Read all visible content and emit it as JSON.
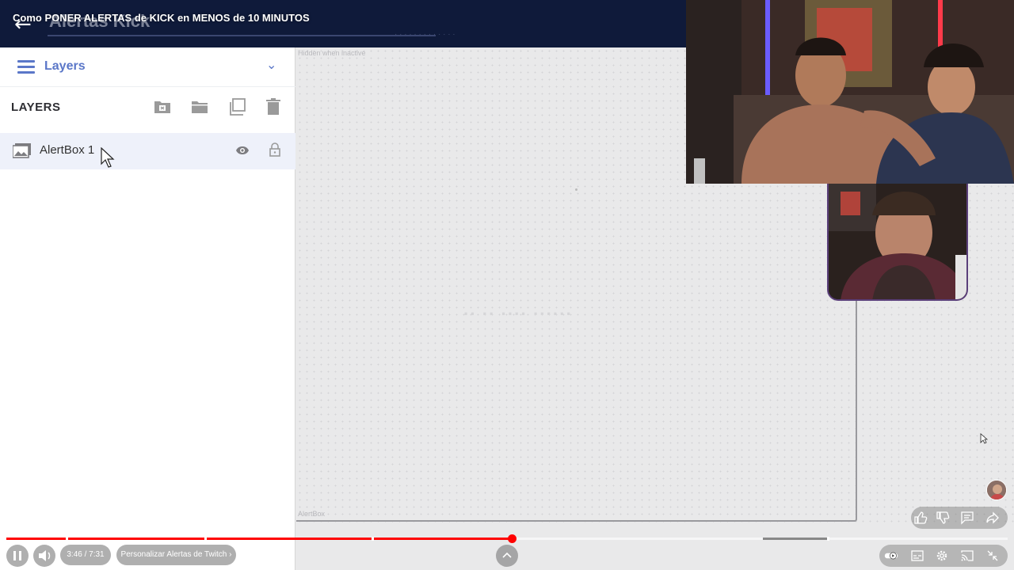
{
  "player": {
    "video_title": "Como PONER ALERTAS de KICK en MENOS de 10 MINUTOS",
    "time_display": "3:46 / 7:31",
    "chapter_label": "Personalizar Alertas de Twitch",
    "progress_fraction": 0.505
  },
  "app": {
    "title": "Alertas Kick",
    "panel_label": "Layers",
    "layers_title": "LAYERS",
    "layers": [
      {
        "name": "AlertBox 1"
      }
    ]
  },
  "canvas": {
    "hidden_note": "Hidden when inactive",
    "alertbox_label": "AlertBox"
  },
  "colors": {
    "topbar_bg": "#0f1a3a",
    "accent_blue": "#5b77c8",
    "progress_red": "#ff0000",
    "selected_row_bg": "#eef1fa"
  },
  "icons": {
    "back": "arrow-left-icon",
    "menu": "hamburger-icon",
    "expand": "chevron-down-icon",
    "tools": [
      "add-folder-icon",
      "folder-icon",
      "duplicate-icon",
      "trash-icon"
    ],
    "layer": "image-icon",
    "visibility": "eye-icon",
    "lock": "lock-icon"
  }
}
